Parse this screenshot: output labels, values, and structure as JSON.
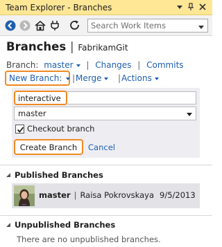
{
  "window": {
    "title": "Team Explorer - Branches"
  },
  "toolbar": {
    "search_placeholder": "Search Work Items"
  },
  "header": {
    "title": "Branches",
    "separator": "|",
    "repository": "FabrikamGit"
  },
  "nav": {
    "branch_label": "Branch:",
    "branch_value": "master",
    "changes": "Changes",
    "commits": "Commits",
    "separator": "|"
  },
  "actions_row": {
    "new_branch": "New Branch:",
    "merge": "Merge",
    "actions": "Actions",
    "separator": "|"
  },
  "new_branch_form": {
    "name_value": "interactive",
    "base_branch": "master",
    "checkout_label": "Checkout branch",
    "checkout_checked": true,
    "create_button": "Create Branch",
    "cancel": "Cancel"
  },
  "published": {
    "title": "Published Branches",
    "rows": [
      {
        "branch": "master",
        "separator": "|",
        "author": "Raisa Pokrovskaya",
        "date": "9/5/2013"
      }
    ]
  },
  "unpublished": {
    "title": "Unpublished Branches",
    "empty_message": "There are no unpublished branches."
  },
  "colors": {
    "title_bar": "#ffe796",
    "link": "#1e5faf",
    "highlight_outline": "#ef8a22",
    "form_panel": "#eeeef2",
    "list_row": "#e2e2e7"
  },
  "icons": [
    "back-icon",
    "forward-icon",
    "home-icon",
    "plug-icon",
    "refresh-icon",
    "search-dropdown-icon",
    "dropdown-arrow-icon",
    "pin-icon",
    "close-icon"
  ]
}
